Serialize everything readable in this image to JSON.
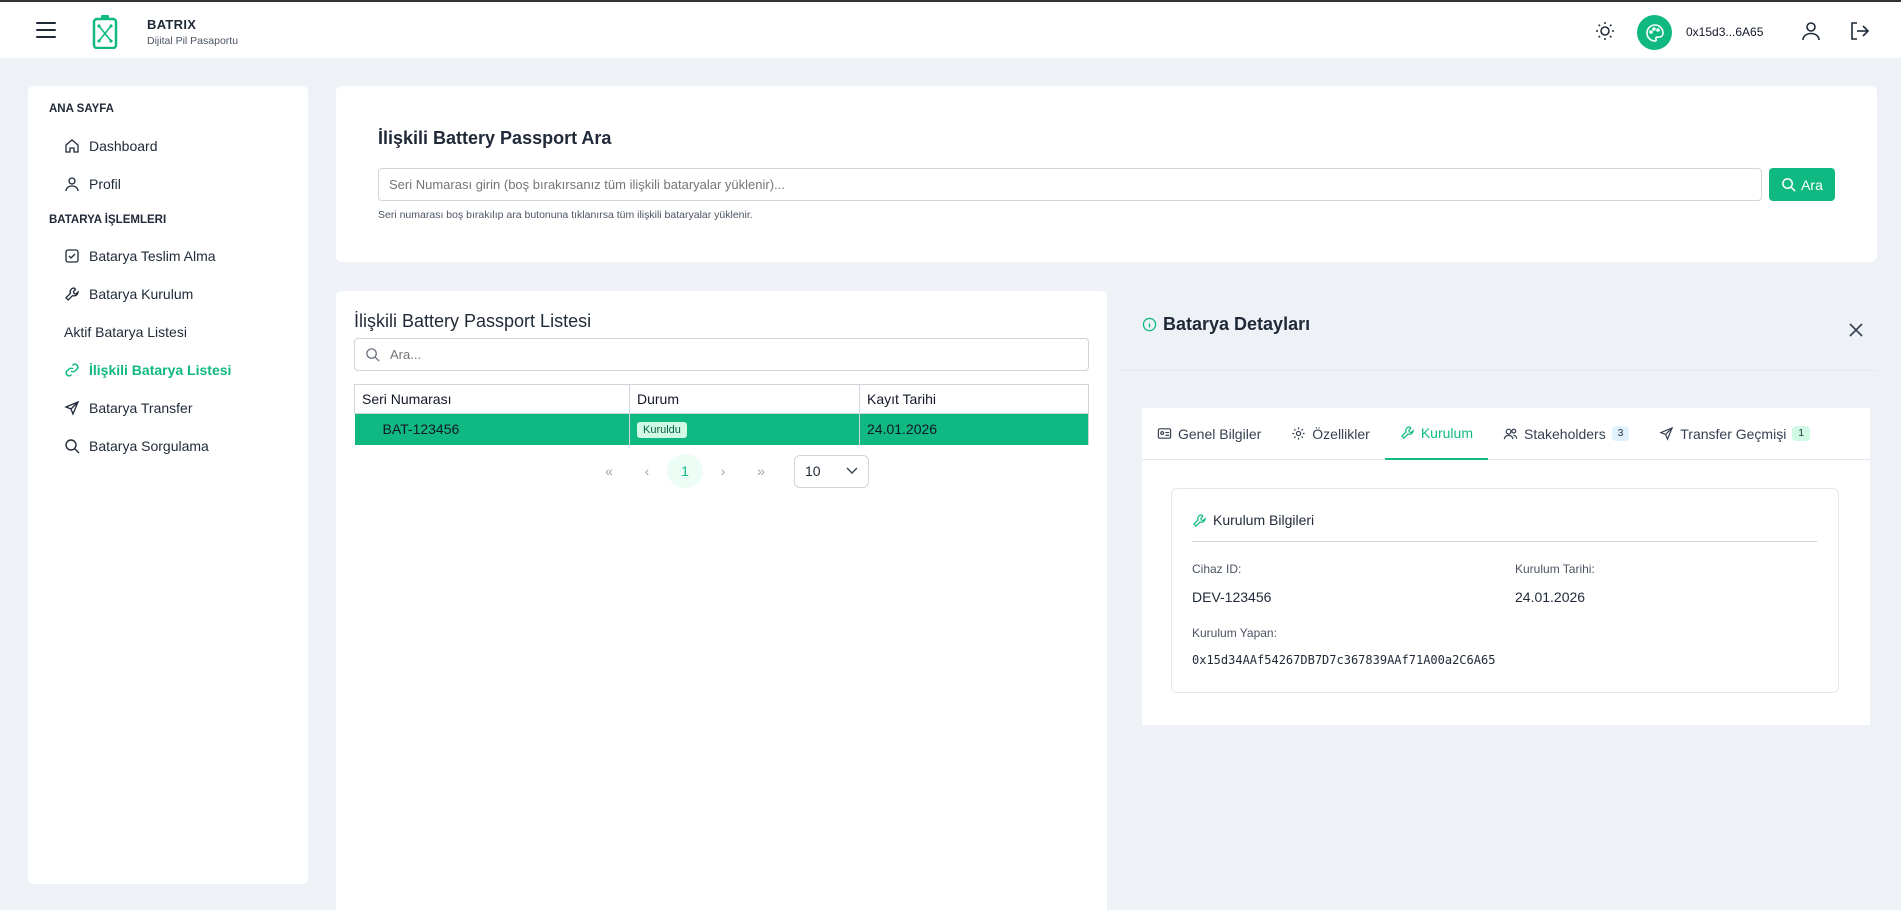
{
  "header": {
    "brand_name": "BATRIX",
    "brand_subtitle": "Dijital Pil Pasaportu",
    "wallet": "0x15d3...6A65"
  },
  "sidebar": {
    "section1": "ANA SAYFA",
    "section2": "BATARYA İŞLEMLERI",
    "items": [
      {
        "label": "Dashboard",
        "icon": "home-icon"
      },
      {
        "label": "Profil",
        "icon": "user-icon"
      },
      {
        "label": "Batarya Teslim Alma",
        "icon": "check-square-icon"
      },
      {
        "label": "Batarya Kurulum",
        "icon": "wrench-icon"
      },
      {
        "label": "Aktif Batarya Listesi",
        "icon": ""
      },
      {
        "label": "İlişkili Batarya Listesi",
        "icon": "link-icon"
      },
      {
        "label": "Batarya Transfer",
        "icon": "send-icon"
      },
      {
        "label": "Batarya Sorgulama",
        "icon": "search-icon"
      }
    ]
  },
  "search": {
    "title": "İlişkili Battery Passport Ara",
    "placeholder": "Seri Numarası girin (boş bırakırsanız tüm ilişkili bataryalar yüklenir)...",
    "button": "Ara",
    "hint": "Seri numarası boş bırakılıp ara butonuna tıklanırsa tüm ilişkili bataryalar yüklenir."
  },
  "list": {
    "title": "İlişkili Battery Passport Listesi",
    "filter_placeholder": "Ara...",
    "columns": [
      "Seri Numarası",
      "Durum",
      "Kayıt Tarihi"
    ],
    "rows": [
      {
        "serial": "BAT-123456",
        "status": "Kuruldu",
        "date": "24.01.2026"
      }
    ],
    "current_page": "1",
    "per_page": "10"
  },
  "detail": {
    "title": "Batarya Detayları",
    "tabs": [
      {
        "label": "Genel Bilgiler",
        "count": ""
      },
      {
        "label": "Özellikler",
        "count": ""
      },
      {
        "label": "Kurulum",
        "count": ""
      },
      {
        "label": "Stakeholders",
        "count": "3"
      },
      {
        "label": "Transfer Geçmişi",
        "count": "1"
      }
    ],
    "active_tab": "Kurulum",
    "section_title": "Kurulum Bilgileri",
    "device_id_label": "Cihaz ID:",
    "device_id": "DEV-123456",
    "install_date_label": "Kurulum Tarihi:",
    "install_date": "24.01.2026",
    "installer_label": "Kurulum Yapan:",
    "installer": "0x15d34AAf54267DB7D7c367839AAf71A00a2C6A65"
  },
  "colors": {
    "accent": "#10b981",
    "background": "#eef2f6"
  }
}
